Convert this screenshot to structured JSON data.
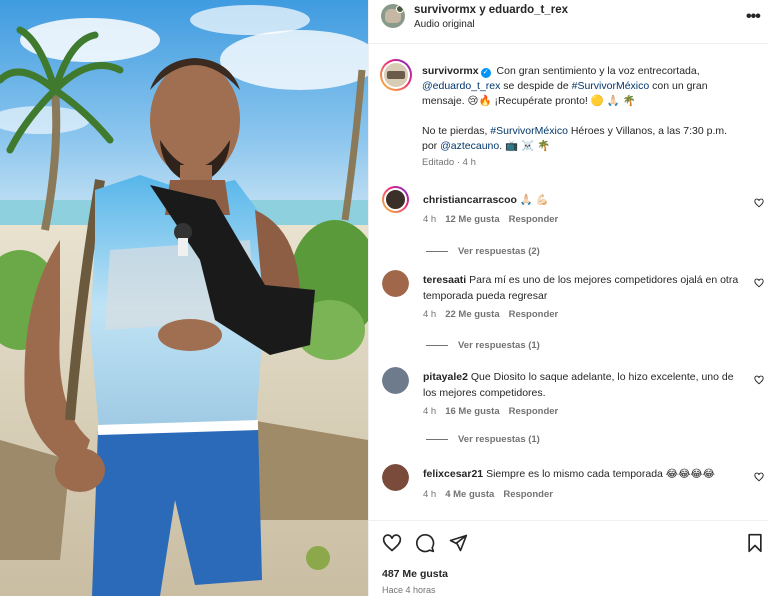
{
  "header": {
    "names": "survivormx y eduardo_t_rex",
    "audio": "Audio original",
    "more_icon": "more-horizontal-icon"
  },
  "caption": {
    "username": "survivormx",
    "line1_text": " Con gran sentimiento y la voz entrecortada,",
    "mention1": "@eduardo_t_rex",
    "line2_mid": " se despide de ",
    "hashtag1": "#SurvivorMéxico",
    "line2_end": " con un gran",
    "line3": "mensaje. 😢🔥 ¡Recupérate pronto! 🟡 🙏🏻 🌴",
    "line4_start": "No te pierdas, ",
    "hashtag2": "#SurvivorMéxico",
    "line4_end": " Héroes y Villanos, a las 7:30 p.m.",
    "line5_start": "por ",
    "mention2": "@aztecauno",
    "line5_end": ". 📺 ☠️ 🌴",
    "meta": "Editado · 4 h"
  },
  "comments": [
    {
      "username": "christiancarrascoo",
      "text": "🙏🏻 💪🏻",
      "time": "4 h",
      "likes": "12 Me gusta",
      "reply": "Responder",
      "view_replies": "Ver respuestas (2)",
      "avatar_color": "#3b2f2a"
    },
    {
      "username": "teresaati",
      "text": "Para mí es uno de los mejores competidores ojalá en otra temporada pueda regresar",
      "time": "4 h",
      "likes": "22 Me gusta",
      "reply": "Responder",
      "view_replies": "Ver respuestas (1)",
      "avatar_color": "#a0674a"
    },
    {
      "username": "pitayale2",
      "text": "Que Diosito lo saque adelante, lo hizo excelente, uno de los mejores competidores.",
      "time": "4 h",
      "likes": "16 Me gusta",
      "reply": "Responder",
      "view_replies": "Ver respuestas (1)",
      "avatar_color": "#6e7b8c"
    },
    {
      "username": "felixcesar21",
      "text": "Siempre es lo mismo cada temporada 😂😂😂😂",
      "time": "4 h",
      "likes": "4 Me gusta",
      "reply": "Responder",
      "avatar_color": "#7a4a3a"
    }
  ],
  "footer": {
    "likes": "487 Me gusta",
    "time": "Hace 4 horas"
  },
  "colors": {
    "link": "#00376b",
    "verified": "#0095f6",
    "muted": "#737373"
  }
}
